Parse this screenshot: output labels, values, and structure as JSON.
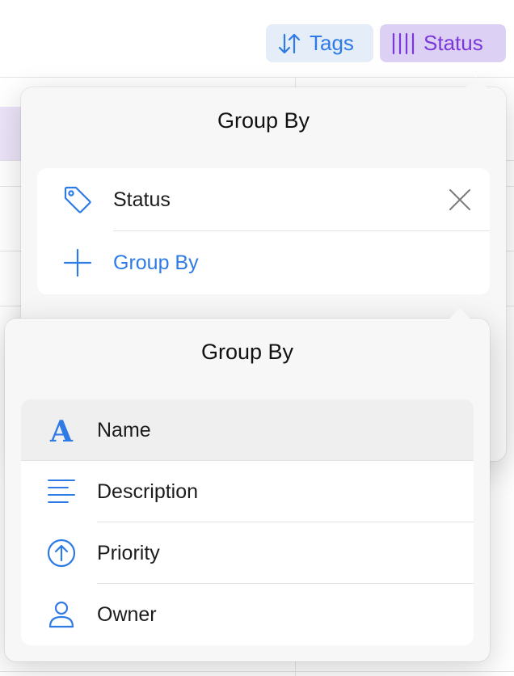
{
  "toolbar": {
    "tags_label": "Tags",
    "status_label": "Status"
  },
  "group_popover": {
    "title": "Group By",
    "current_group": {
      "icon": "tag-icon",
      "label": "Status"
    },
    "add_label": "Group By"
  },
  "picker_popover": {
    "title": "Group By",
    "items": [
      {
        "icon": "text-format-icon",
        "label": "Name",
        "selected": true
      },
      {
        "icon": "text-lines-icon",
        "label": "Description",
        "selected": false
      },
      {
        "icon": "arrow-up-circle-icon",
        "label": "Priority",
        "selected": false
      },
      {
        "icon": "person-icon",
        "label": "Owner",
        "selected": false
      }
    ]
  },
  "colors": {
    "accent_blue": "#2f7be6",
    "accent_purple": "#7a38d8",
    "tags_bg": "#e4edf8",
    "status_bg": "#ddd0f5"
  }
}
